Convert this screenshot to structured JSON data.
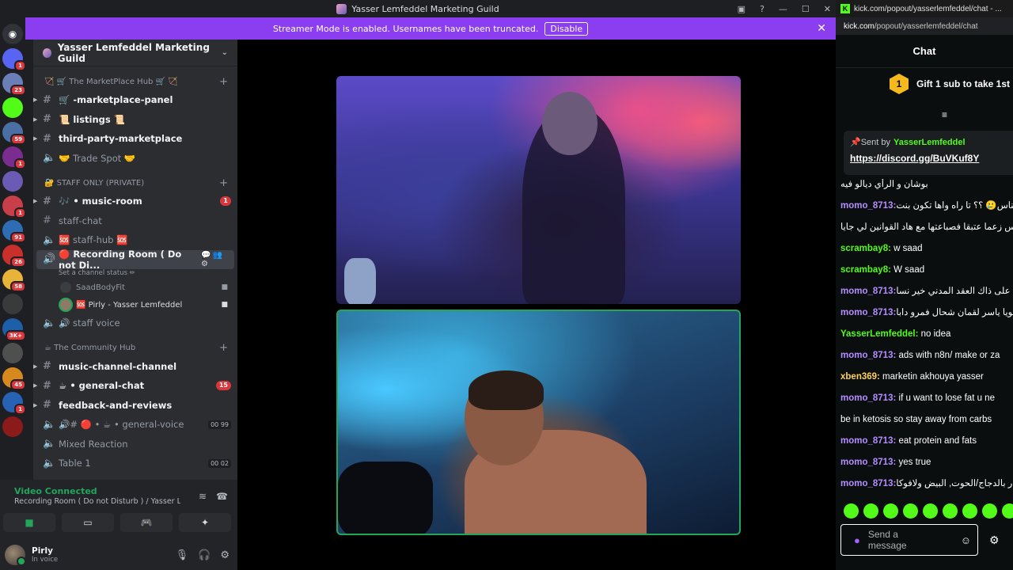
{
  "window": {
    "title": "Yasser Lemfeddel Marketing Guild"
  },
  "banner": {
    "text": "Streamer Mode is enabled. Usernames have been truncated.",
    "disable_label": "Disable"
  },
  "rail": {
    "badges": [
      "1",
      "23",
      "",
      "59",
      "1",
      "",
      "1",
      "91",
      "26",
      "58",
      "",
      "3K+",
      "",
      "45",
      "1",
      ""
    ],
    "colors": [
      "#5865f2",
      "#6a7fb8",
      "#53fc18",
      "#4a6fa5",
      "#7b2d8f",
      "#6b5bb5",
      "#c83f49",
      "#2e6db4",
      "#c9302c",
      "#e8b339",
      "#3a3a3a",
      "#1d5fa8",
      "#4f4f4f",
      "#d8891e",
      "#2862b5",
      "#8b1a1a"
    ]
  },
  "sidebar": {
    "guild_name": "Yasser Lemfeddel Marketing Guild",
    "cat1": "🏹 🛒 The MarketPlace Hub 🛒 🏹",
    "ch_marketplace": "🛒 -marketplace-panel",
    "ch_listings": "📜 listings 📜",
    "ch_thirdparty": "third-party-marketplace",
    "ch_tradespot": "🤝 Trade Spot 🤝",
    "cat2": "🔐 STAFF ONLY (PRIVATE)",
    "ch_musicroom": "🎶 • music-room",
    "ch_musicroom_badge": "1",
    "ch_staffchat": "staff-chat",
    "ch_staffhub": "🆘 staff-hub 🆘",
    "ch_recording": "🔴 Recording Room ( Do not Di...",
    "status_line": "Set a channel status ✏",
    "member1": "SaadBodyFit",
    "member2": "🆘 Pirly - Yasser Lemfeddel",
    "ch_staffvoice": "🔊 staff voice",
    "cat3": "☕ The Community Hub",
    "ch_musicchannel": "music-channel-channel",
    "ch_general": "☕ • general-chat",
    "ch_general_badge": "15",
    "ch_feedback": "feedback-and-reviews",
    "ch_generalvoice": "🔊# 🔴 • ☕ • general-voice",
    "ch_generalvoice_tail": "00 99",
    "ch_mixed": "Mixed Reaction",
    "ch_table": "Table 1",
    "ch_table_tail": "00 02"
  },
  "voice": {
    "status": "Video Connected",
    "channel": "Recording Room ( Do not Disturb ) / Yasser Lem..."
  },
  "user": {
    "name": "Pirly",
    "status": "In voice"
  },
  "chat": {
    "tab_title": "kick.com/popout/yasserlemfeddel/chat - ...",
    "url_host": "kick.com",
    "url_path": "/popout/yasserlemfeddel/chat",
    "header": "Chat",
    "gift_count": "1",
    "gift_text": "Gift 1 sub to take 1st",
    "pinned_sentby": "Sent by",
    "pinned_user": "YasserLemfeddel",
    "pinned_link": "https://discord.gg/BuVKuf8Y",
    "send_placeholder": "Send a message",
    "messages": [
      {
        "user": "",
        "color": "#ffffff",
        "text": "بوشان و الرأي ديالو فيه"
      },
      {
        "user": "momo_8713:",
        "color": "#b48dff",
        "text": "الناس🥲 ؟؟ تا راه واها تكون بنت"
      },
      {
        "user": "",
        "color": "#ffffff",
        "text": "إلناس زعما عتبقا فصباعتها مع هاد القوانين لي جايا"
      },
      {
        "user": "scrambay8:",
        "color": "#53fc18",
        "text": " w saad"
      },
      {
        "user": "scrambay8:",
        "color": "#53fc18",
        "text": " W saad"
      },
      {
        "user": "momo_8713:",
        "color": "#b48dff",
        "text": "لي على ذاك العقد المدني خير نسا"
      },
      {
        "user": "momo_8713:",
        "color": "#b48dff",
        "text": "خويا ياسر لقمان شحال فمرو دابا"
      },
      {
        "user": "YasserLemfeddel:",
        "color": "#53fc18",
        "text": " no idea"
      },
      {
        "user": "momo_8713:",
        "color": "#b48dff",
        "text": " ads with n8n/ make or za"
      },
      {
        "user": "xben369:",
        "color": "#ffd25a",
        "text": " marketin akhouya yasser"
      },
      {
        "user": "momo_8713:",
        "color": "#b48dff",
        "text": " if u want to lose fat u ne"
      },
      {
        "user": "",
        "color": "#ffffff",
        "text": "be in ketosis so stay away from carbs"
      },
      {
        "user": "momo_8713:",
        "color": "#b48dff",
        "text": " eat protein and fats"
      },
      {
        "user": "momo_8713:",
        "color": "#b48dff",
        "text": " yes true"
      },
      {
        "user": "momo_8713:",
        "color": "#b48dff",
        "text": "ر بالدجاج/الحوت, البيض ولافوكا"
      }
    ]
  }
}
